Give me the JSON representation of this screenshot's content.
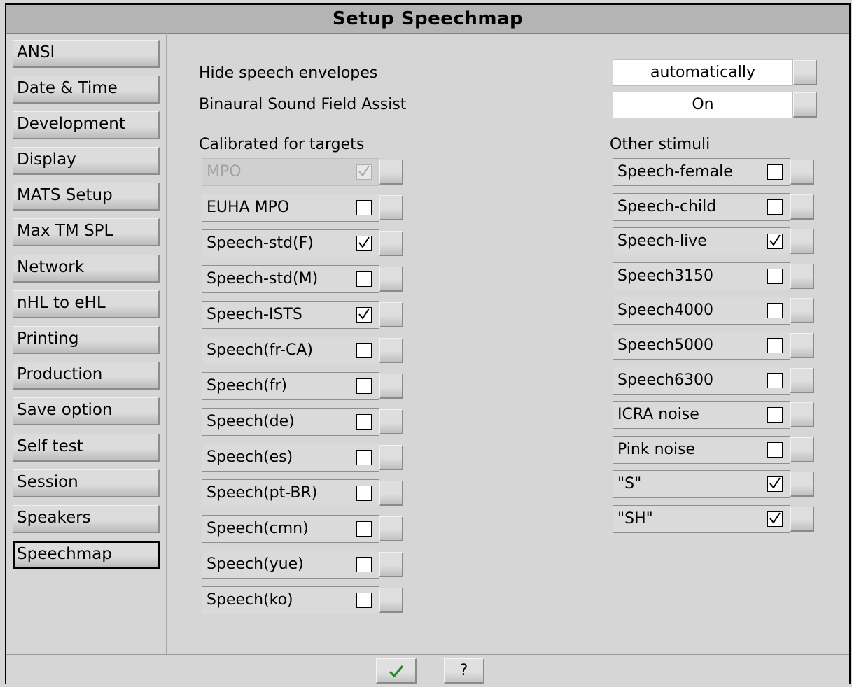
{
  "window": {
    "title": "Setup Speechmap"
  },
  "sidebar": {
    "items": [
      {
        "label": "ANSI"
      },
      {
        "label": "Date & Time"
      },
      {
        "label": "Development"
      },
      {
        "label": "Display"
      },
      {
        "label": "MATS Setup"
      },
      {
        "label": "Max TM SPL"
      },
      {
        "label": "Network"
      },
      {
        "label": "nHL to eHL"
      },
      {
        "label": "Printing"
      },
      {
        "label": "Production"
      },
      {
        "label": "Save option"
      },
      {
        "label": "Self test"
      },
      {
        "label": "Session"
      },
      {
        "label": "Speakers"
      },
      {
        "label": "Speechmap"
      }
    ],
    "active_index": 14
  },
  "settings": {
    "hide_envelopes": {
      "label": "Hide speech envelopes",
      "value": "automatically"
    },
    "binaural": {
      "label": "Binaural Sound Field Assist",
      "value": "On"
    }
  },
  "calibrated": {
    "heading": "Calibrated for targets",
    "items": [
      {
        "label": "MPO",
        "checked": true,
        "disabled": true
      },
      {
        "label": "EUHA MPO",
        "checked": false
      },
      {
        "label": "Speech-std(F)",
        "checked": true
      },
      {
        "label": "Speech-std(M)",
        "checked": false
      },
      {
        "label": "Speech-ISTS",
        "checked": true
      },
      {
        "label": "Speech(fr-CA)",
        "checked": false
      },
      {
        "label": "Speech(fr)",
        "checked": false
      },
      {
        "label": "Speech(de)",
        "checked": false
      },
      {
        "label": "Speech(es)",
        "checked": false
      },
      {
        "label": "Speech(pt-BR)",
        "checked": false
      },
      {
        "label": "Speech(cmn)",
        "checked": false
      },
      {
        "label": "Speech(yue)",
        "checked": false
      },
      {
        "label": "Speech(ko)",
        "checked": false
      }
    ]
  },
  "other": {
    "heading": "Other stimuli",
    "items": [
      {
        "label": "Speech-female",
        "checked": false
      },
      {
        "label": "Speech-child",
        "checked": false
      },
      {
        "label": "Speech-live",
        "checked": true
      },
      {
        "label": "Speech3150",
        "checked": false
      },
      {
        "label": "Speech4000",
        "checked": false
      },
      {
        "label": "Speech5000",
        "checked": false
      },
      {
        "label": "Speech6300",
        "checked": false
      },
      {
        "label": "ICRA noise",
        "checked": false
      },
      {
        "label": "Pink noise",
        "checked": false
      },
      {
        "label": "\"S\"",
        "checked": true
      },
      {
        "label": "\"SH\"",
        "checked": true
      }
    ]
  },
  "footer": {
    "ok_icon": "checkmark-icon",
    "help_label": "?"
  }
}
